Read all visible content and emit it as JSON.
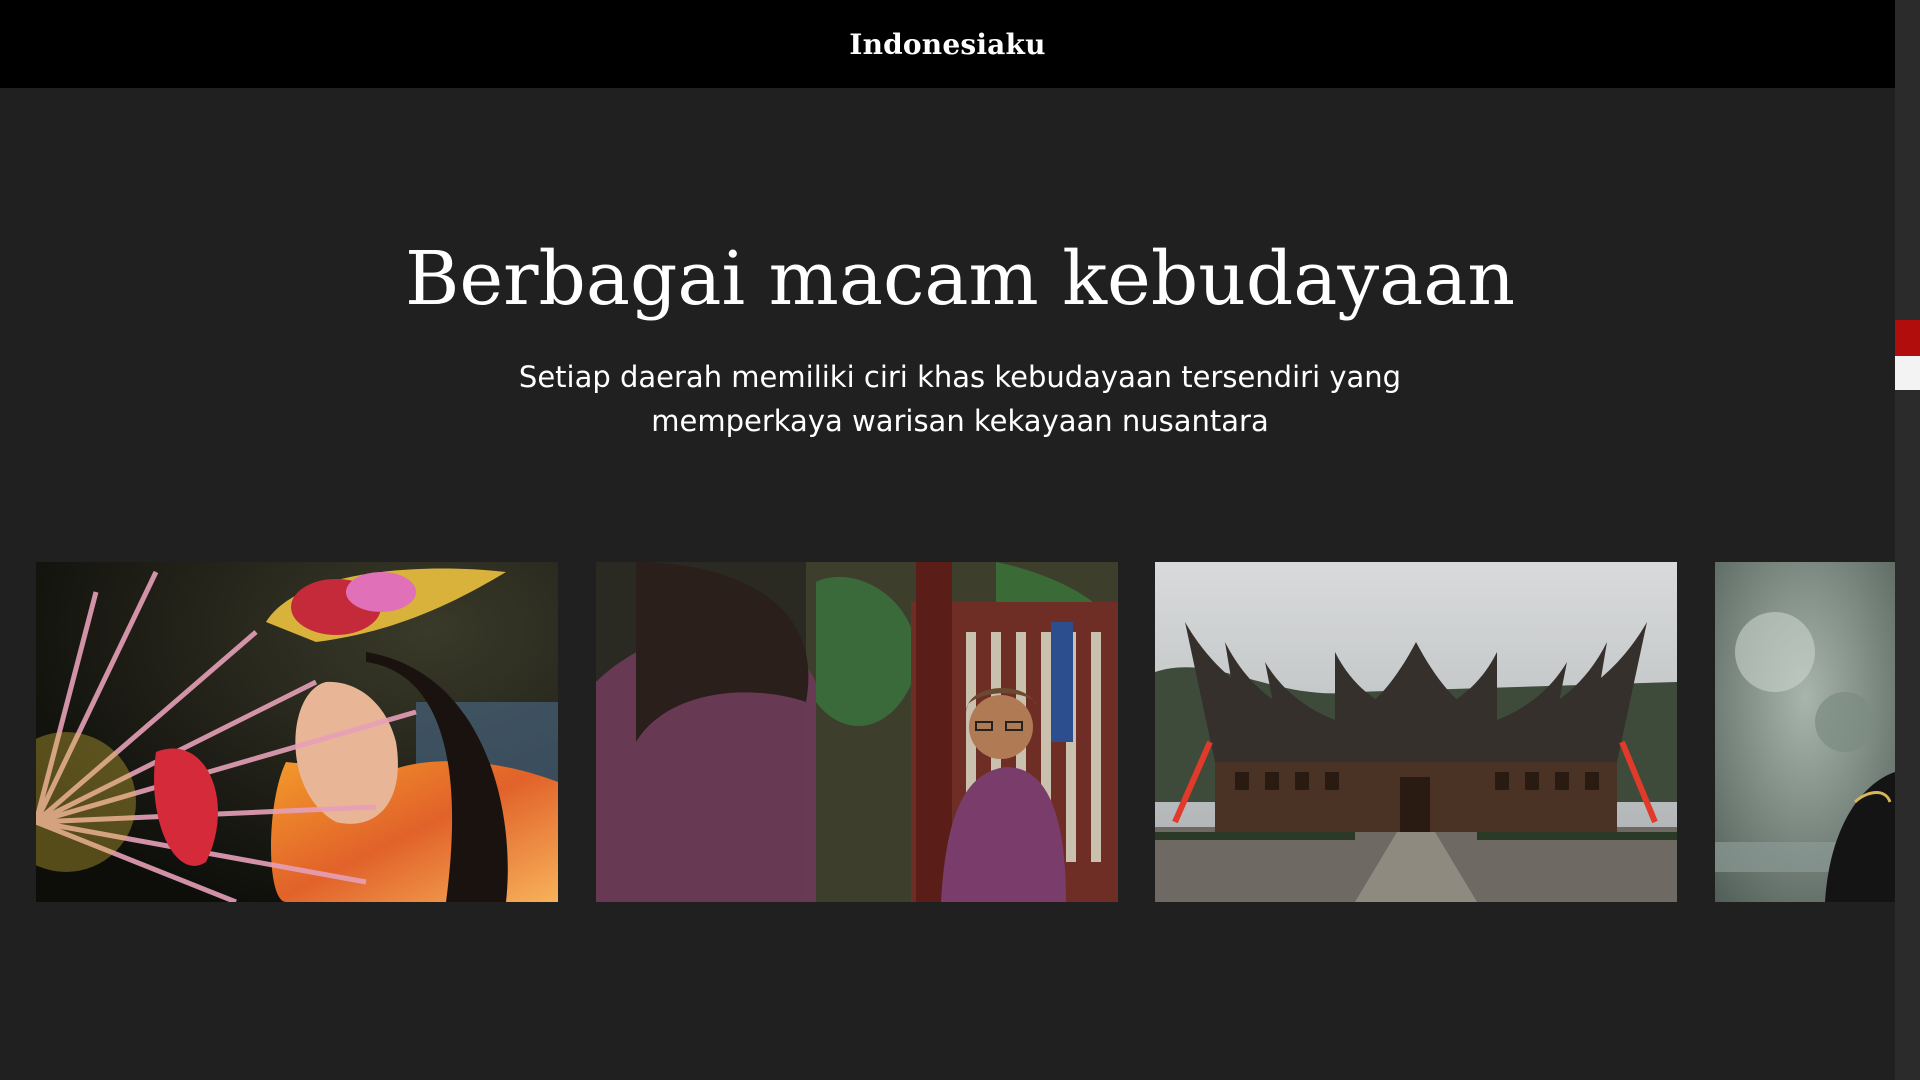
{
  "header": {
    "brand": "Indonesiaku"
  },
  "hero": {
    "title": "Berbagai macam kebudayaan",
    "subtitle_line1": "Setiap daerah memiliki ciri khas kebudayaan tersendiri yang",
    "subtitle_line2": "memperkaya warisan kekayaan nusantara"
  },
  "gallery": {
    "items": [
      {
        "subject": "dancer-with-fan-photo"
      },
      {
        "subject": "man-in-traditional-attire-photo"
      },
      {
        "subject": "rumah-gadang-photo"
      },
      {
        "subject": "partial-portrait-photo"
      }
    ]
  },
  "colors": {
    "header_bg": "#000000",
    "page_bg": "#202020",
    "text": "#ffffff",
    "flag_red": "#b20d0d",
    "flag_white": "#f3f3f3"
  }
}
